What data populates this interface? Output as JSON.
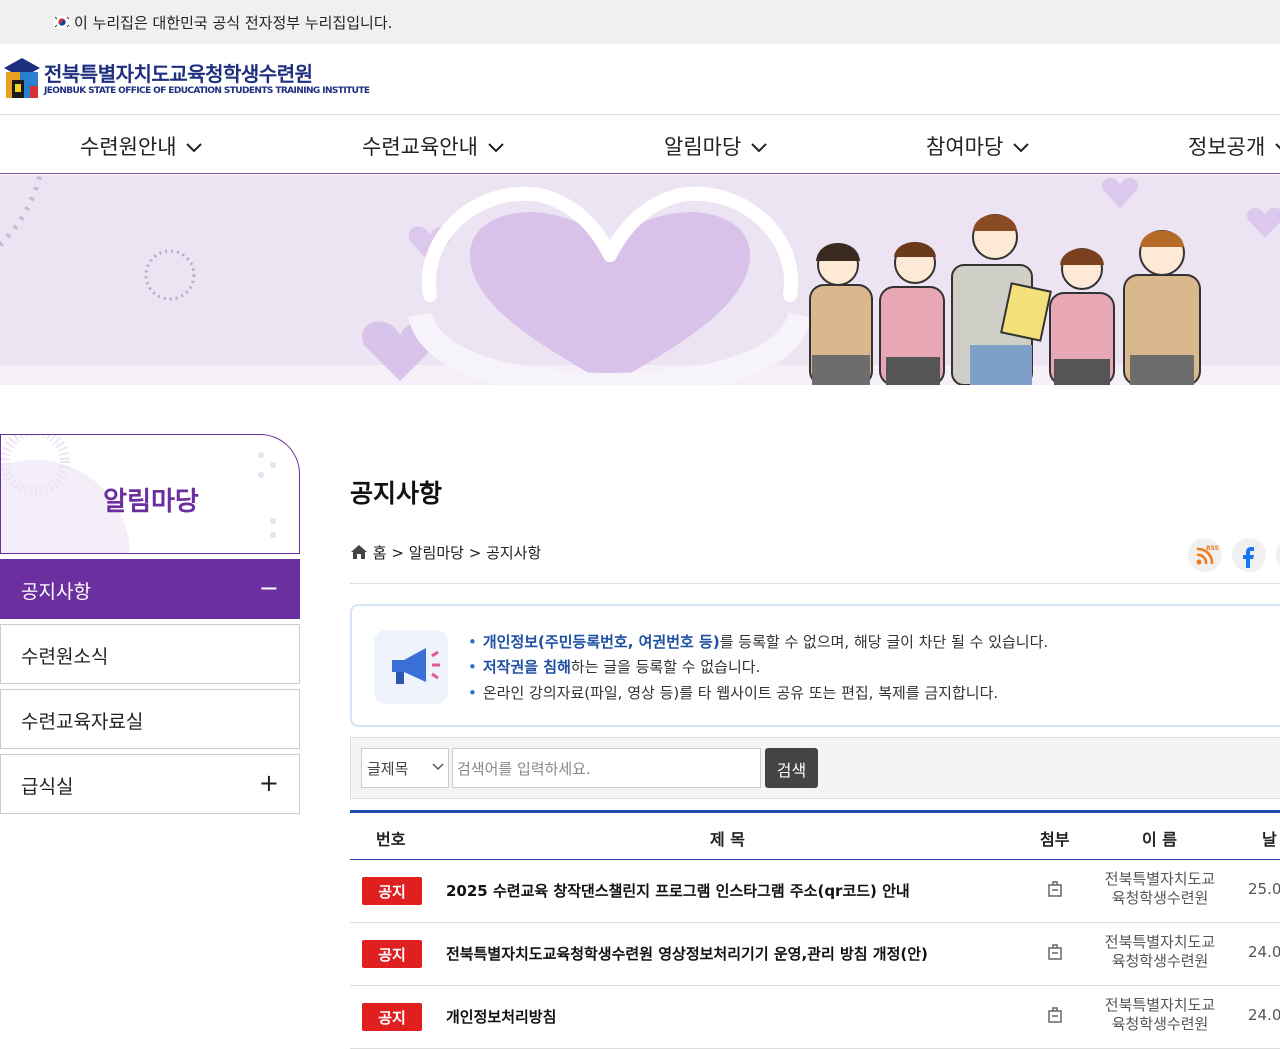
{
  "gov_banner": {
    "text": "이 누리집은 대한민국 공식 전자정부 누리집입니다."
  },
  "header": {
    "logo_title": "전북특별자치도교육청학생수련원",
    "logo_subtitle": "JEONBUK STATE OFFICE OF EDUCATION STUDENTS TRAINING INSTITUTE"
  },
  "gnb": {
    "items": [
      {
        "label": "수련원안내"
      },
      {
        "label": "수련교육안내"
      },
      {
        "label": "알림마당"
      },
      {
        "label": "참여마당"
      },
      {
        "label": "정보공개"
      }
    ]
  },
  "sidebar": {
    "title": "알림마당",
    "items": [
      {
        "label": "공지사항",
        "sign": "−"
      },
      {
        "label": "수련원소식"
      },
      {
        "label": "수련교육자료실"
      },
      {
        "label": "급식실",
        "sign": "+"
      }
    ]
  },
  "content": {
    "title": "공지사항",
    "breadcrumb": {
      "home": "홈",
      "sep": ">",
      "level1": "알림마당",
      "level2": "공지사항"
    },
    "notices": {
      "line1_strong": "개인정보(주민등록번호, 여권번호 등)",
      "line1_rest": "를 등록할 수 없으며, 해당 글이 차단 될 수 있습니다.",
      "line2_strong": "저작권을 침해",
      "line2_rest": "하는 글을 등록할 수 없습니다.",
      "line3": "온라인 강의자료(파일, 영상 등)를 타 웹사이트 공유 또는 편집, 복제를 금지합니다."
    },
    "search": {
      "select_value": "글제목",
      "placeholder": "검색어를 입력하세요.",
      "button": "검색"
    },
    "table": {
      "headers": {
        "no": "번호",
        "title": "제 목",
        "attach": "첨부",
        "name": "이 름",
        "date": "날"
      },
      "rows": [
        {
          "badge": "공지",
          "title": "2025 수련교육 창작댄스챌린지 프로그램 인스타그램 주소(qr코드) 안내",
          "author_1": "전북특별자치도교",
          "author_2": "육청학생수련원",
          "date": "25.0"
        },
        {
          "badge": "공지",
          "title": "전북특별자치도교육청학생수련원 영상정보처리기기 운영,관리 방침 개정(안)",
          "author_1": "전북특별자치도교",
          "author_2": "육청학생수련원",
          "date": "24.0"
        },
        {
          "badge": "공지",
          "title": "개인정보처리방침",
          "author_1": "전북특별자치도교",
          "author_2": "육청학생수련원",
          "date": "24.0"
        }
      ]
    }
  },
  "share": {
    "rss_label": "RSS"
  },
  "colors": {
    "brand": "#6b2fa0",
    "navy": "#1f2f80",
    "table_accent": "#1f4fa8",
    "notice_badge": "#e02020"
  }
}
